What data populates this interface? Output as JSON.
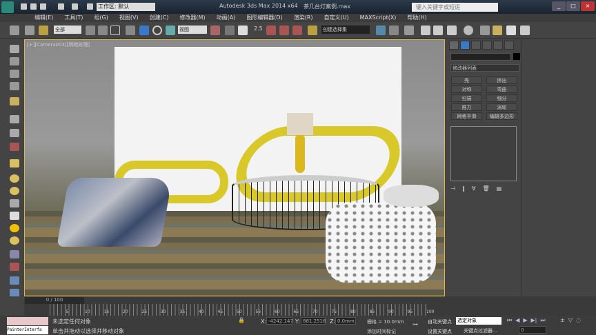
{
  "title_bar": {
    "app_title": "Autodesk 3ds Max  2014 x64",
    "file_title": "茶几台灯案例.max",
    "workspace": "工作区: 默认",
    "search_placeholder": "键入关键字或短语"
  },
  "menu": [
    "编辑(E)",
    "工具(T)",
    "组(G)",
    "视图(V)",
    "创建(C)",
    "修改器(M)",
    "动画(A)",
    "图形编辑器(D)",
    "渲染(R)",
    "自定义(U)",
    "MAXScript(X)",
    "帮助(H)"
  ],
  "toolbar": {
    "filter": "全部",
    "coord": "视图",
    "selection_set": "创建选择集",
    "snap_angle": "2.5"
  },
  "viewport": {
    "label": "[+][Camera003][明暗处理]"
  },
  "command_panel": {
    "modifier_list": "修改器列表",
    "buttons": [
      "壳",
      "挤出",
      "对称",
      "弯曲",
      "扫描",
      "细分",
      "推力",
      "涡轮",
      "网格平滑",
      "编辑多边形"
    ]
  },
  "timeline": {
    "frame": "0 / 100",
    "ticks": [
      "5",
      "10",
      "15",
      "20",
      "25",
      "30",
      "35",
      "40",
      "45",
      "50",
      "55",
      "60",
      "65",
      "70",
      "75",
      "80",
      "85",
      "90",
      "95",
      "100"
    ]
  },
  "status": {
    "selection": "未选定任何对象",
    "prompt": "单击并拖动以选择并移动对象",
    "x": "-4242.147",
    "y": "881.2516",
    "z": "0.0mm",
    "grid": "栅格 = 10.0mm",
    "add_time_tag": "添加时间标记",
    "auto_key": "自动关键点",
    "set_key": "设置关键点",
    "key_mode": "选定对象",
    "key_filters": "关键点过滤器...",
    "current_frame": "0",
    "script_label": "PainterInterfa"
  }
}
